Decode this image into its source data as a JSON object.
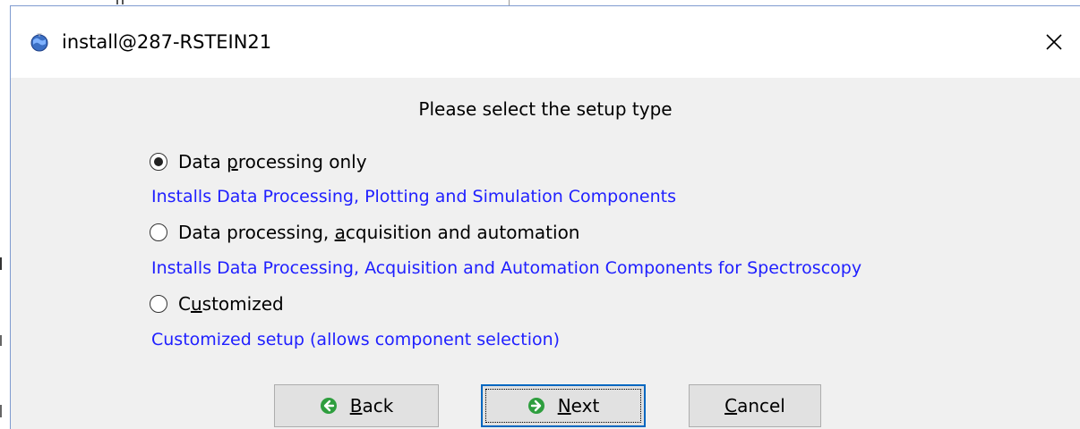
{
  "window": {
    "title": "install@287-RSTEIN21"
  },
  "dialog": {
    "heading": "Please select the setup type",
    "options": [
      {
        "label_pre": "Data ",
        "label_accel": "p",
        "label_post": "rocessing only",
        "description": "Installs Data Processing, Plotting and Simulation Components",
        "selected": true
      },
      {
        "label_pre": "Data processing, ",
        "label_accel": "a",
        "label_post": "cquisition and automation",
        "description": "Installs Data Processing, Acquisition and Automation Components for Spectroscopy",
        "selected": false
      },
      {
        "label_pre": "C",
        "label_accel": "u",
        "label_post": "stomized",
        "description": "Customized setup (allows component selection)",
        "selected": false
      }
    ]
  },
  "buttons": {
    "back": {
      "accel": "B",
      "rest": "ack"
    },
    "next": {
      "accel": "N",
      "rest": "ext"
    },
    "cancel": {
      "accel": "C",
      "rest": "ancel"
    }
  },
  "colors": {
    "description_text": "#2020ff",
    "nav_icon_green": "#2e9e3e",
    "default_button_border": "#0067c0"
  },
  "icons": {
    "app": "installer-globe-icon",
    "close": "close-icon",
    "back": "arrow-left-circle-icon",
    "next": "arrow-right-circle-icon"
  }
}
